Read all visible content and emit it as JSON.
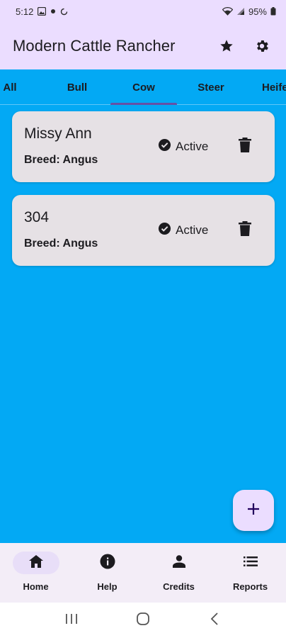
{
  "status_bar": {
    "time": "5:12",
    "battery": "95%",
    "icons": [
      "image-icon",
      "dot-icon",
      "sync-icon",
      "wifi-icon",
      "signal-icon",
      "battery-icon"
    ]
  },
  "app_bar": {
    "title": "Modern Cattle Rancher",
    "actions": [
      "star-icon",
      "gear-icon"
    ]
  },
  "tabs": {
    "items": [
      {
        "label": "All"
      },
      {
        "label": "Bull"
      },
      {
        "label": "Cow"
      },
      {
        "label": "Steer"
      },
      {
        "label": "Heife"
      }
    ],
    "selected": "Cow"
  },
  "cattle_list": [
    {
      "name": "Missy Ann",
      "breed": "Breed: Angus",
      "status": "Active"
    },
    {
      "name": "304",
      "breed": "Breed: Angus",
      "status": "Active"
    }
  ],
  "fab": {
    "icon": "plus-icon"
  },
  "bottom_nav": {
    "items": [
      {
        "label": "Home",
        "icon": "home-icon",
        "active": true
      },
      {
        "label": "Help",
        "icon": "info-icon",
        "active": false
      },
      {
        "label": "Credits",
        "icon": "person-icon",
        "active": false
      },
      {
        "label": "Reports",
        "icon": "list-icon",
        "active": false
      }
    ]
  },
  "colors": {
    "background": "#03A9F4",
    "app_bar": "#EBDDFF",
    "card": "#E6E1E5",
    "indicator": "#6750A4",
    "bottom_nav": "#F3EDF7",
    "nav_active_pill": "#E8DEF8"
  }
}
